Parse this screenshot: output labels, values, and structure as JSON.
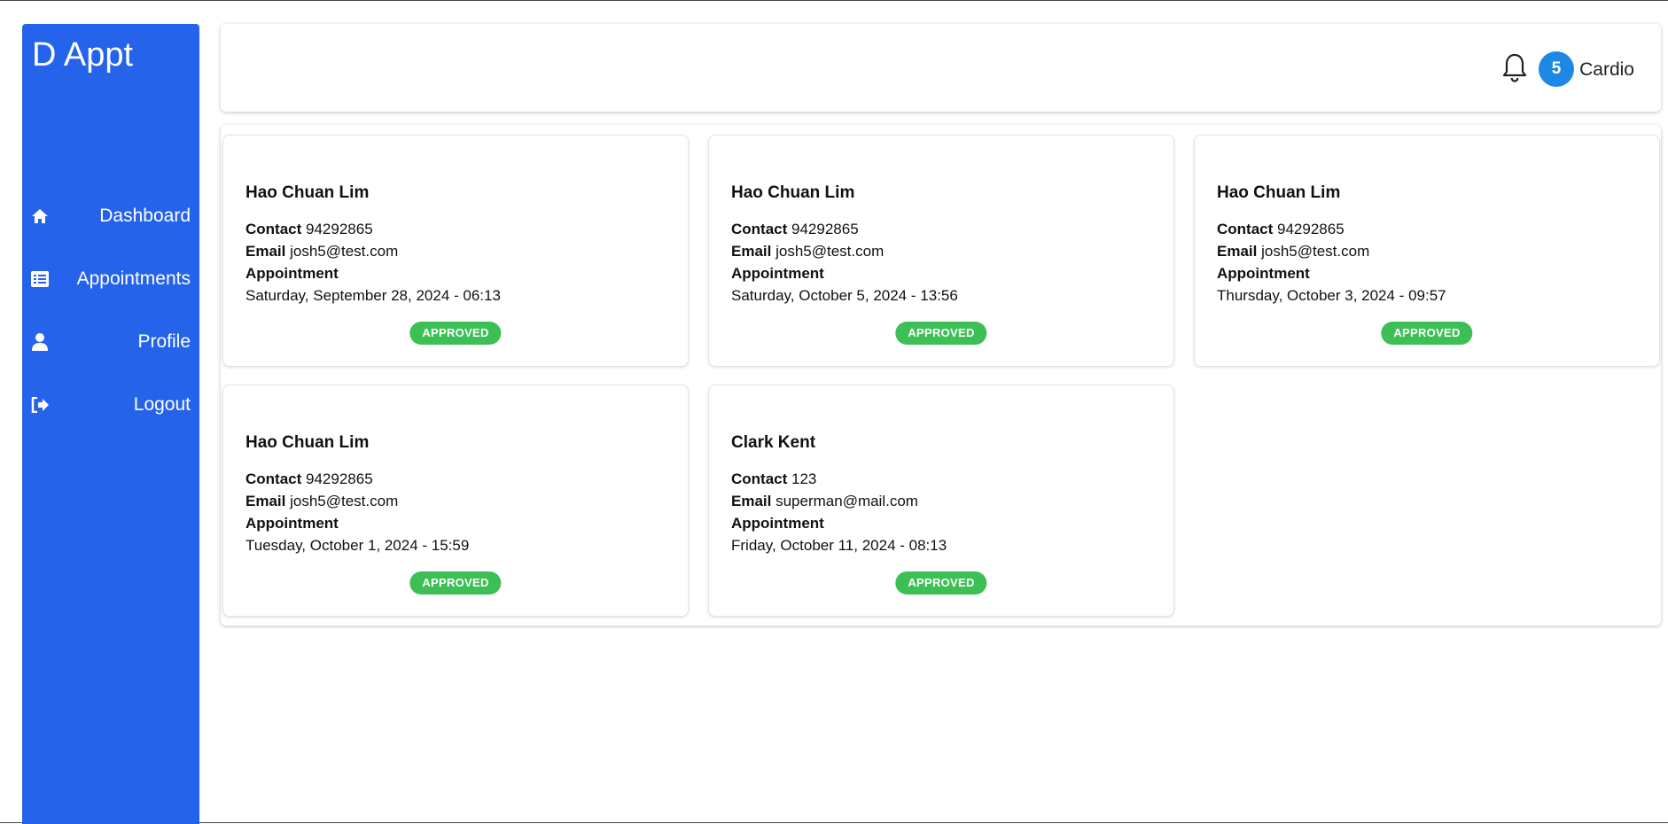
{
  "app": {
    "brand": "D Appt"
  },
  "sidebar": {
    "items": [
      {
        "label": "Dashboard",
        "icon": "home-icon"
      },
      {
        "label": "Appointments",
        "icon": "list-icon"
      },
      {
        "label": "Profile",
        "icon": "user-icon"
      },
      {
        "label": "Logout",
        "icon": "logout-icon"
      }
    ]
  },
  "header": {
    "notification_count": "5",
    "user_name": "Cardio"
  },
  "labels": {
    "contact": "Contact",
    "email": "Email",
    "appointment": "Appointment"
  },
  "appointments": [
    {
      "name": "Hao Chuan Lim",
      "contact": "94292865",
      "email": "josh5@test.com",
      "datetime": "Saturday, September 28, 2024 - 06:13",
      "status": "APPROVED"
    },
    {
      "name": "Hao Chuan Lim",
      "contact": "94292865",
      "email": "josh5@test.com",
      "datetime": "Saturday, October 5, 2024 - 13:56",
      "status": "APPROVED"
    },
    {
      "name": "Hao Chuan Lim",
      "contact": "94292865",
      "email": "josh5@test.com",
      "datetime": "Thursday, October 3, 2024 - 09:57",
      "status": "APPROVED"
    },
    {
      "name": "Hao Chuan Lim",
      "contact": "94292865",
      "email": "josh5@test.com",
      "datetime": "Tuesday, October 1, 2024 - 15:59",
      "status": "APPROVED"
    },
    {
      "name": "Clark Kent",
      "contact": "123",
      "email": "superman@mail.com",
      "datetime": "Friday, October 11, 2024 - 08:13",
      "status": "APPROVED"
    }
  ],
  "colors": {
    "sidebar": "#2563eb",
    "badge": "#1e88e5",
    "status_approved": "#3cbf55"
  }
}
